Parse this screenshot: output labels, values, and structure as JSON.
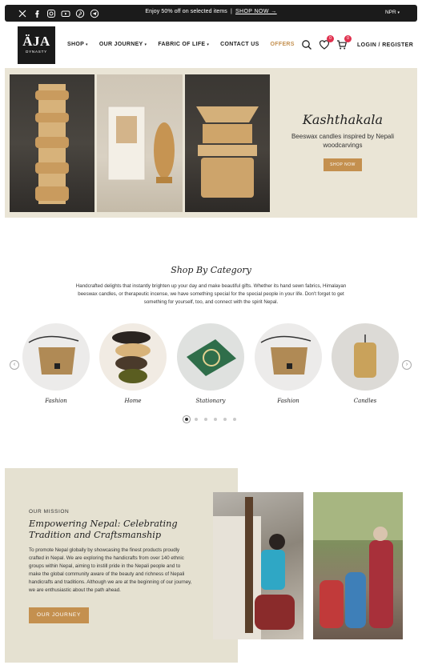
{
  "topbar": {
    "social_icons": [
      "x-icon",
      "facebook-icon",
      "instagram-icon",
      "youtube-icon",
      "pinterest-icon",
      "telegram-icon"
    ],
    "promo_text": "Enjoy 50% off on selected items",
    "promo_separator": "|",
    "promo_link": "SHOP NOW →",
    "currency": "NPR"
  },
  "header": {
    "logo_big": "ÄJA",
    "logo_small": "DYNASTY",
    "nav": [
      {
        "label": "SHOP",
        "dropdown": true
      },
      {
        "label": "OUR JOURNEY",
        "dropdown": true
      },
      {
        "label": "FABRIC OF LIFE",
        "dropdown": true
      },
      {
        "label": "CONTACT US",
        "dropdown": false
      },
      {
        "label": "OFFERS",
        "dropdown": false
      }
    ],
    "wishlist_count": "0",
    "cart_count": "0",
    "login_label": "LOGIN / REGISTER"
  },
  "hero": {
    "title": "Kashthakala",
    "subtitle": "Beeswax candles inspired by Nepali woodcarvings",
    "button": "SHOP NOW"
  },
  "category": {
    "title": "Shop By Category",
    "description": "Handcrafted delights that instantly brighten up your day and make beautiful gifts. Whether its hand sewn fabrics, Himalayan beeswax candles, or therapeutic incense, we have something special for the special people in your life. Don't forget to get something for yourself, too, and connect with the spirit Nepal.",
    "items": [
      {
        "label": "Fashion"
      },
      {
        "label": "Home"
      },
      {
        "label": "Stationary"
      },
      {
        "label": "Fashion"
      },
      {
        "label": "Candles"
      }
    ],
    "page_count": 6,
    "active_page": 1
  },
  "mission": {
    "eyebrow": "OUR MISSION",
    "title": "Empowering Nepal: Celebrating Tradition and Craftsmanship",
    "body": "To promote Nepal globally by showcasing the finest products proudly crafted in Nepal. We are exploring the handicrafts from over 140 ethnic groups within Nepal, aiming to instill pride in the Nepali people and to make the global community aware of the beauty and richness of Nepali handicrafts and traditions. Although we are at the beginning of our journey, we are enthusiastic about the path ahead.",
    "button": "OUR JOURNEY"
  },
  "colors": {
    "accent": "#c4904f",
    "topbar": "#1b1b1b",
    "badge": "#e0314e",
    "hero_bg": "#eae5d6",
    "mission_bg": "#e5e1d1"
  }
}
